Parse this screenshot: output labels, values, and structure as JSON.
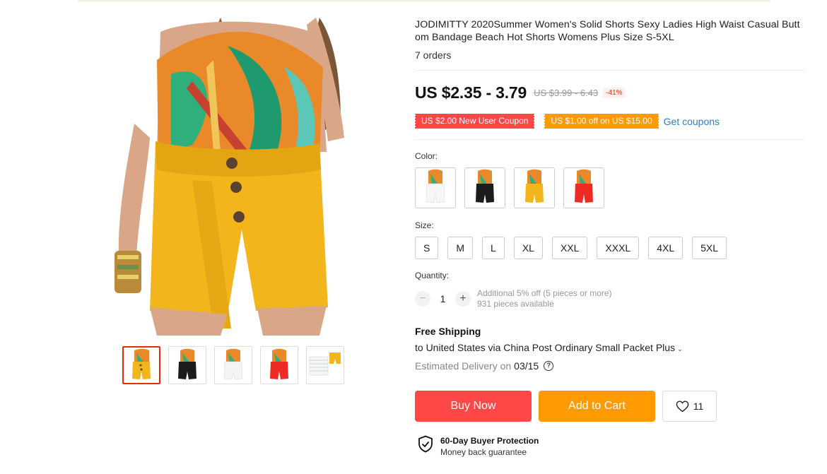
{
  "product": {
    "title": "JODIMITTY 2020Summer Women's Solid Shorts Sexy Ladies High Waist Casual Butt",
    "title_line2": "om Bandage Beach Hot Shorts Womens Plus Size S-5XL",
    "orders": "7 orders"
  },
  "pricing": {
    "price": "US $2.35 - 3.79",
    "original": "US $3.99 - 6.43",
    "discount": "-41%"
  },
  "coupons": {
    "new_user": "US $2.00 New User Coupon",
    "store": "US $1.00 off on US $15.00",
    "get_label": "Get coupons"
  },
  "color": {
    "label": "Color:",
    "options": [
      "white",
      "black",
      "yellow",
      "red"
    ]
  },
  "size": {
    "label": "Size:",
    "options": [
      "S",
      "M",
      "L",
      "XL",
      "XXL",
      "XXXL",
      "4XL",
      "5XL"
    ]
  },
  "quantity": {
    "label": "Quantity:",
    "value": "1",
    "minus": "−",
    "plus": "+",
    "note": "Additional 5% off (5 pieces or more)",
    "available": "931 pieces available"
  },
  "shipping": {
    "title": "Free Shipping",
    "to": "to United States via China Post Ordinary Small Packet Plus",
    "chevron": "⌄",
    "estimated_label": "Estimated Delivery on",
    "estimated_date": "03/15",
    "help": "?"
  },
  "actions": {
    "buy": "Buy Now",
    "cart": "Add to Cart",
    "wishlist_count": "11"
  },
  "protection": {
    "title": "60-Day Buyer Protection",
    "subtitle": "Money back guarantee"
  },
  "colors": {
    "accent_red": "#ff4747",
    "accent_orange": "#ff9a00",
    "link_blue": "#2e7ec8",
    "shorts_yellow": "#f2b61c"
  },
  "icons": [
    "heart-icon",
    "shield-check-icon",
    "help-circle-icon",
    "chevron-down-icon"
  ]
}
